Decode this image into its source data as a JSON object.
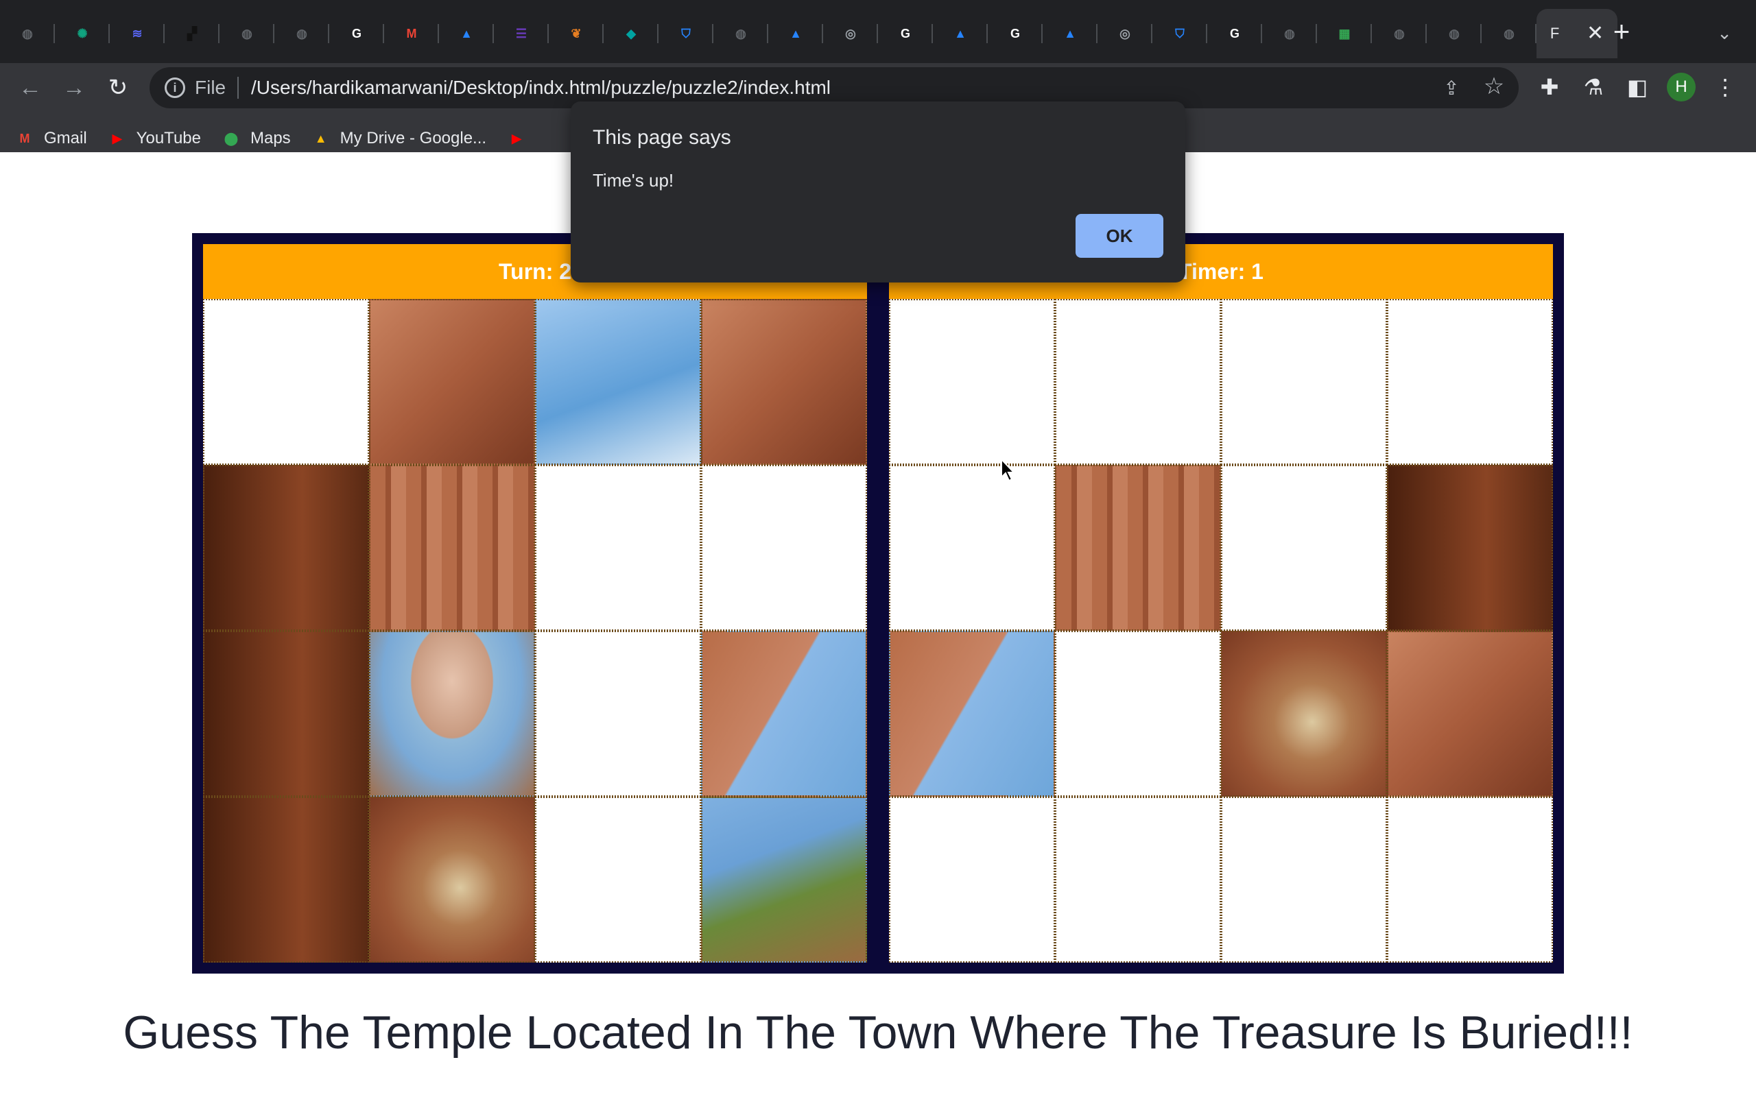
{
  "browser": {
    "tabs": [
      {
        "icon": "globe-icon",
        "color": "#5f6368",
        "glyph": "◍"
      },
      {
        "icon": "openai-icon",
        "color": "#10a37f",
        "glyph": "✺"
      },
      {
        "icon": "layers-icon",
        "color": "#5865f2",
        "glyph": "≋"
      },
      {
        "icon": "pixel-icon",
        "color": "#111111",
        "glyph": "▞"
      },
      {
        "icon": "globe-icon",
        "color": "#5f6368",
        "glyph": "◍"
      },
      {
        "icon": "globe-icon",
        "color": "#5f6368",
        "glyph": "◍"
      },
      {
        "icon": "google-icon",
        "color": "#ffffff",
        "glyph": "G"
      },
      {
        "icon": "gmail-icon",
        "color": "#ea4335",
        "glyph": "M"
      },
      {
        "icon": "atlassian-icon",
        "color": "#2684ff",
        "glyph": "▲"
      },
      {
        "icon": "forms-icon",
        "color": "#673ab7",
        "glyph": "☰"
      },
      {
        "icon": "leaf-icon",
        "color": "#e67e22",
        "glyph": "❦"
      },
      {
        "icon": "diamond-icon",
        "color": "#00a3a1",
        "glyph": "◆"
      },
      {
        "icon": "bitbucket-icon",
        "color": "#2684ff",
        "glyph": "⛉"
      },
      {
        "icon": "globe-icon",
        "color": "#5f6368",
        "glyph": "◍"
      },
      {
        "icon": "atlassian-icon",
        "color": "#2684ff",
        "glyph": "▲"
      },
      {
        "icon": "chrome-icon",
        "color": "#9aa0a6",
        "glyph": "◎"
      },
      {
        "icon": "google-icon",
        "color": "#ffffff",
        "glyph": "G"
      },
      {
        "icon": "atlassian-icon",
        "color": "#2684ff",
        "glyph": "▲"
      },
      {
        "icon": "google-icon",
        "color": "#ffffff",
        "glyph": "G"
      },
      {
        "icon": "atlassian-icon",
        "color": "#2684ff",
        "glyph": "▲"
      },
      {
        "icon": "chrome-icon",
        "color": "#9aa0a6",
        "glyph": "◎"
      },
      {
        "icon": "bitbucket-icon",
        "color": "#2684ff",
        "glyph": "⛉"
      },
      {
        "icon": "google-icon",
        "color": "#ffffff",
        "glyph": "G"
      },
      {
        "icon": "globe-icon",
        "color": "#5f6368",
        "glyph": "◍"
      },
      {
        "icon": "sheets-icon",
        "color": "#34a853",
        "glyph": "▦"
      },
      {
        "icon": "globe-icon",
        "color": "#5f6368",
        "glyph": "◍"
      },
      {
        "icon": "globe-icon",
        "color": "#5f6368",
        "glyph": "◍"
      },
      {
        "icon": "globe-icon",
        "color": "#5f6368",
        "glyph": "◍"
      }
    ],
    "active_tab": {
      "title": "F",
      "close": "✕"
    },
    "new_tab": "+",
    "tab_search": "⌄",
    "nav": {
      "back": "←",
      "forward": "→",
      "reload": "↻"
    },
    "omnibox": {
      "info": "i",
      "scheme": "File",
      "url": "/Users/hardikamarwani/Desktop/indx.html/puzzle/puzzle2/index.html",
      "share": "⇪",
      "star": "☆"
    },
    "toolbar_icons": {
      "extensions": "✚",
      "labs": "⚗",
      "sidepanel": "◧",
      "menu": "⋮"
    },
    "avatar": "H",
    "bookmarks": [
      {
        "label": "Gmail",
        "icon": "gmail-icon",
        "color": "#ea4335",
        "glyph": "M"
      },
      {
        "label": "YouTube",
        "icon": "youtube-icon",
        "color": "#ff0000",
        "glyph": "▶"
      },
      {
        "label": "Maps",
        "icon": "maps-icon",
        "color": "#34a853",
        "glyph": "⬤"
      },
      {
        "label": "My Drive - Google...",
        "icon": "drive-icon",
        "color": "#fbbc04",
        "glyph": "▲"
      },
      {
        "label": "",
        "icon": "youtube-icon",
        "color": "#ff0000",
        "glyph": "▶"
      }
    ]
  },
  "game": {
    "left_header": "Turn: 2",
    "right_header": "Timer: 1",
    "left_tiles": [
      "empty",
      "stone",
      "sky",
      "stone",
      "dark",
      "carved",
      "empty",
      "empty",
      "dark",
      "dome",
      "empty",
      "mix",
      "dark",
      "arch",
      "empty",
      "green"
    ],
    "right_tiles": [
      "empty",
      "empty",
      "empty",
      "empty",
      "empty",
      "carved",
      "empty",
      "dark",
      "mix",
      "empty",
      "arch",
      "stone",
      "empty",
      "empty",
      "empty",
      "empty"
    ]
  },
  "title": "Guess The Temple Located In The Town Where The Treasure Is Buried!!!",
  "alert": {
    "title": "This page says",
    "message": "Time's up!",
    "ok": "OK"
  }
}
